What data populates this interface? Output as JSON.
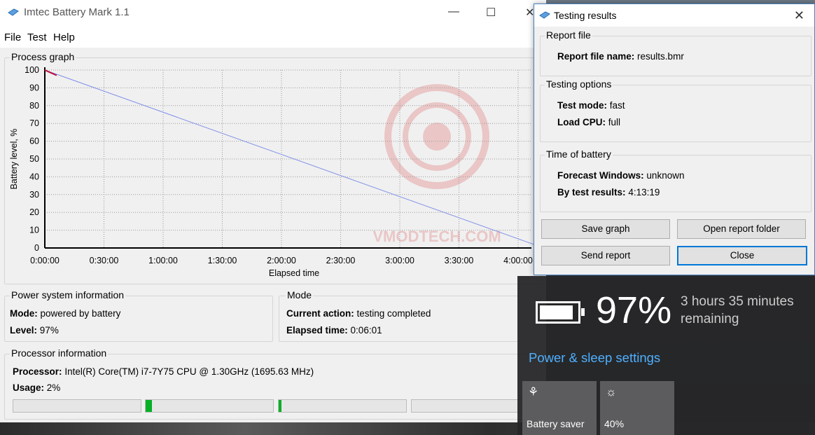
{
  "window": {
    "title": "Imtec Battery Mark 1.1",
    "controls": {
      "minimize": "—",
      "maximize": "☐",
      "close": "✕"
    }
  },
  "menu": [
    "File",
    "Test",
    "Help"
  ],
  "graph": {
    "title": "Process graph",
    "xlabel": "Elapsed time",
    "ylabel": "Battery level, %"
  },
  "chart_data": {
    "type": "line",
    "xlabel": "Elapsed time",
    "ylabel": "Battery level, %",
    "x_ticks": [
      "0:00:00",
      "0:30:00",
      "1:00:00",
      "1:30:00",
      "2:00:00",
      "2:30:00",
      "3:00:00",
      "3:30:00",
      "4:00:00"
    ],
    "y_ticks": [
      0,
      10,
      20,
      30,
      40,
      50,
      60,
      70,
      80,
      90,
      100
    ],
    "ylim": [
      0,
      100
    ],
    "grid": true,
    "series": [
      {
        "values_x_min": [
          0,
          253
        ],
        "values_y": [
          100,
          0
        ],
        "color": "#7f8ee8"
      },
      {
        "values_x_min": [
          0,
          2,
          4,
          6
        ],
        "values_y": [
          100,
          99,
          98,
          97
        ],
        "color": "#c0103c"
      }
    ]
  },
  "power": {
    "title": "Power system information",
    "mode_label": "Mode:",
    "mode_value": "powered by battery",
    "level_label": "Level:",
    "level_value": "97%"
  },
  "mode": {
    "title": "Mode",
    "action_label": "Current action:",
    "action_value": "testing completed",
    "elapsed_label": "Elapsed time:",
    "elapsed_value": "0:06:01"
  },
  "processor": {
    "title": "Processor information",
    "proc_label": "Processor:",
    "proc_value": "Intel(R) Core(TM) i7-7Y75 CPU @ 1.30GHz  (1695.63 MHz)",
    "usage_label": "Usage:",
    "usage_value": "2%",
    "core_usage": [
      0,
      0.05,
      0.02,
      0
    ]
  },
  "dialog": {
    "title": "Testing results",
    "report_group": "Report file",
    "report_label": "Report file name:",
    "report_value": "results.bmr",
    "options_group": "Testing options",
    "test_mode_label": "Test mode:",
    "test_mode_value": "fast",
    "load_cpu_label": "Load CPU:",
    "load_cpu_value": "full",
    "time_group": "Time of battery",
    "forecast_label": "Forecast Windows:",
    "forecast_value": "unknown",
    "bytest_label": "By test results:",
    "bytest_value": "4:13:19",
    "buttons": {
      "save_graph": "Save graph",
      "open_folder": "Open report folder",
      "send_report": "Send report",
      "close": "Close"
    }
  },
  "flyout": {
    "percent": "97%",
    "remaining": "3 hours 35 minutes remaining",
    "settings_link": "Power & sleep settings",
    "tile_saver": "Battery saver",
    "tile_brightness": "40%",
    "battery_level": 0.97
  },
  "watermark": "VMODTECH.COM"
}
